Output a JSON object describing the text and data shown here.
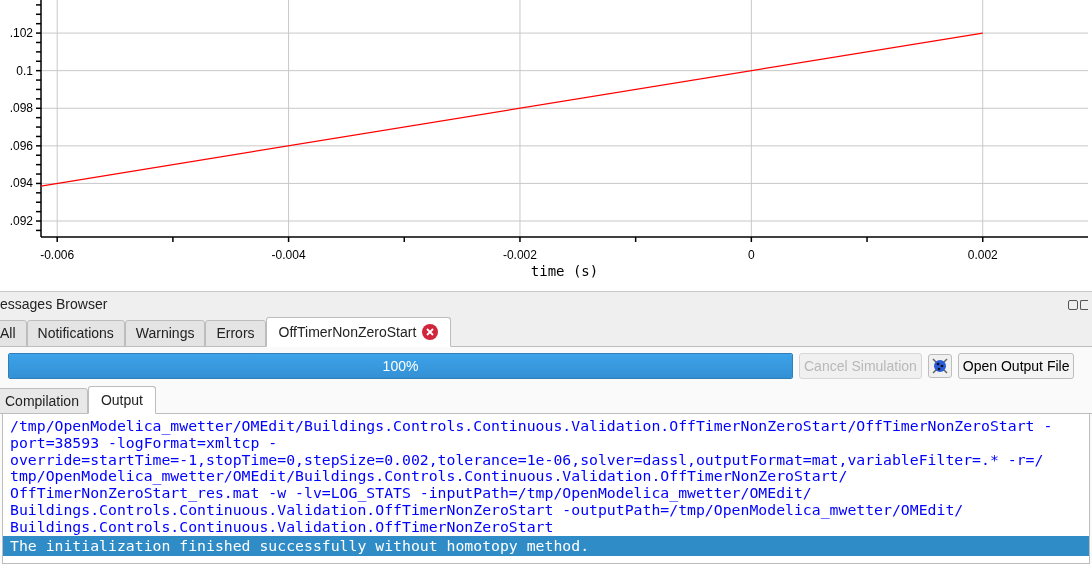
{
  "plot": {
    "chart_data": {
      "type": "line",
      "grid": true,
      "xlabel": "time (s)",
      "xlim": [
        -0.00614,
        0.00291
      ],
      "ylim": [
        0.09115,
        0.10376
      ],
      "xticks": [
        -0.006,
        -0.004,
        -0.002,
        0,
        0.002
      ],
      "yticks": [
        {
          "value": 0.102,
          "label": ".102"
        },
        {
          "value": 0.1,
          "label": "0.1"
        },
        {
          "value": 0.098,
          "label": ".098"
        },
        {
          "value": 0.096,
          "label": ".096"
        },
        {
          "value": 0.094,
          "label": ".094"
        },
        {
          "value": 0.092,
          "label": ".092"
        }
      ],
      "x": [
        -0.00614,
        0.002
      ],
      "series": [
        {
          "color": "#ff0000",
          "values": [
            0.09386,
            0.102
          ]
        }
      ]
    }
  },
  "messages_browser": {
    "title": "essages Browser",
    "tabs": [
      {
        "label": "All",
        "selected": false
      },
      {
        "label": "Notifications",
        "selected": false
      },
      {
        "label": "Warnings",
        "selected": false
      },
      {
        "label": "Errors",
        "selected": false
      },
      {
        "label": "OffTimerNonZeroStart",
        "selected": true,
        "closable": true
      }
    ],
    "progress": {
      "level": 1,
      "text": "100%"
    },
    "buttons": [
      {
        "kind": "text",
        "label": "Cancel Simulation",
        "disabled": true
      },
      {
        "kind": "icon"
      },
      {
        "kind": "text",
        "label": "Open Output File",
        "disabled": false
      }
    ],
    "subtabs": [
      {
        "label": "Compilation",
        "selected": false
      },
      {
        "label": "Output",
        "selected": true
      }
    ],
    "output": [
      {
        "selected": false,
        "lines": [
          "/tmp/OpenModelica_mwetter/OMEdit/Buildings.Controls.Continuous.Validation.OffTimerNonZeroStart/OffTimerNonZeroStart -",
          "port=38593 -logFormat=xmltcp -",
          "override=startTime=-1,stopTime=0,stepSize=0.002,tolerance=1e-06,solver=dassl,outputFormat=mat,variableFilter=.* -r=/",
          "tmp/OpenModelica_mwetter/OMEdit/Buildings.Controls.Continuous.Validation.OffTimerNonZeroStart/",
          "OffTimerNonZeroStart_res.mat -w -lv=LOG_STATS -inputPath=/tmp/OpenModelica_mwetter/OMEdit/",
          "Buildings.Controls.Continuous.Validation.OffTimerNonZeroStart -outputPath=/tmp/OpenModelica_mwetter/OMEdit/",
          "Buildings.Controls.Continuous.Validation.OffTimerNonZeroStart"
        ]
      },
      {
        "selected": true,
        "lines": [
          "The initialization finished successfully without homotopy method."
        ]
      }
    ]
  }
}
